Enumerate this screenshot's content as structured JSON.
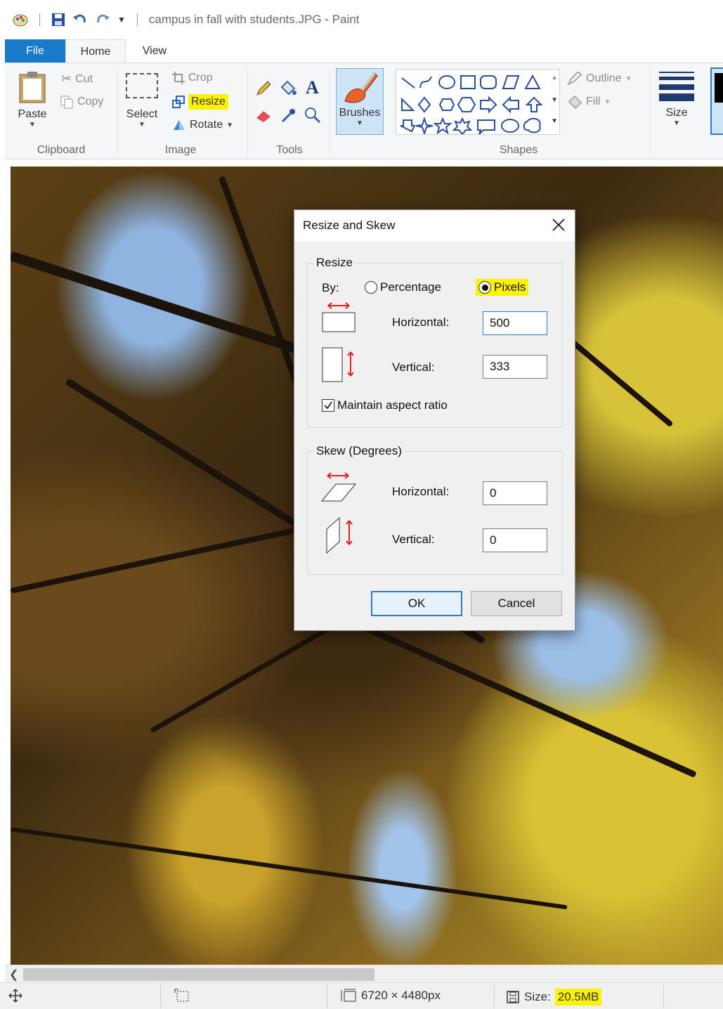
{
  "window": {
    "title": "campus in fall with students.JPG - Paint"
  },
  "tabs": [
    {
      "label": "File"
    },
    {
      "label": "Home"
    },
    {
      "label": "View"
    }
  ],
  "ribbon": {
    "clipboard": {
      "group_label": "Clipboard",
      "paste": "Paste",
      "cut": "Cut",
      "copy": "Copy"
    },
    "image": {
      "group_label": "Image",
      "select": "Select",
      "crop": "Crop",
      "resize": "Resize",
      "rotate": "Rotate"
    },
    "tools": {
      "group_label": "Tools"
    },
    "brushes": {
      "label": "Brushes"
    },
    "shapes": {
      "group_label": "Shapes",
      "outline": "Outline",
      "fill": "Fill"
    },
    "size": {
      "label": "Size"
    }
  },
  "dialog": {
    "title": "Resize and Skew",
    "resize": {
      "legend": "Resize",
      "by_label": "By:",
      "options": [
        {
          "label": "Percentage",
          "selected": false
        },
        {
          "label": "Pixels",
          "selected": true
        }
      ],
      "horizontal_label": "Horizontal:",
      "horizontal_value": "500",
      "vertical_label": "Vertical:",
      "vertical_value": "333",
      "maintain_label": "Maintain aspect ratio",
      "maintain_checked": true
    },
    "skew": {
      "legend": "Skew (Degrees)",
      "horizontal_label": "Horizontal:",
      "horizontal_value": "0",
      "vertical_label": "Vertical:",
      "vertical_value": "0"
    },
    "ok_label": "OK",
    "cancel_label": "Cancel"
  },
  "status": {
    "dimensions": "6720 × 4480px",
    "size_label": "Size:",
    "size_value": "20.5MB"
  },
  "colors": {
    "highlight": "#fff200",
    "file_tab": "#1979ca",
    "accent_blue": "#2b79d6",
    "arrow_red": "#e02020"
  }
}
